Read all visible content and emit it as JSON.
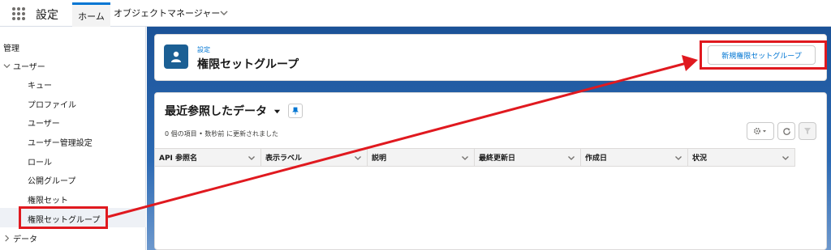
{
  "topbar": {
    "app_name": "設定",
    "tab_home": "ホーム",
    "tab_object_manager": "オブジェクトマネージャー"
  },
  "sidebar": {
    "heading": "管理",
    "group_users": "ユーザー",
    "items": [
      "キュー",
      "プロファイル",
      "ユーザー",
      "ユーザー管理設定",
      "ロール",
      "公開グループ",
      "権限セット",
      "権限セットグループ"
    ],
    "active_item": "権限セットグループ",
    "group_data": "データ"
  },
  "header": {
    "breadcrumb": "設定",
    "title": "権限セットグループ",
    "new_button": "新規権限セットグループ"
  },
  "list": {
    "title": "最近参照したデータ",
    "meta": "0 個の項目 • 数秒前 に更新されました",
    "columns": [
      "API 参照名",
      "表示ラベル",
      "説明",
      "最終更新日",
      "作成日",
      "状況"
    ]
  },
  "colors": {
    "accent": "#0176d3",
    "highlight": "#e0191f",
    "banner": "#1b5297"
  },
  "icons": [
    "app-launcher-icon",
    "chevron-down-icon",
    "chevron-right-icon",
    "user-icon",
    "pin-icon",
    "gear-icon",
    "refresh-icon",
    "filter-icon"
  ]
}
